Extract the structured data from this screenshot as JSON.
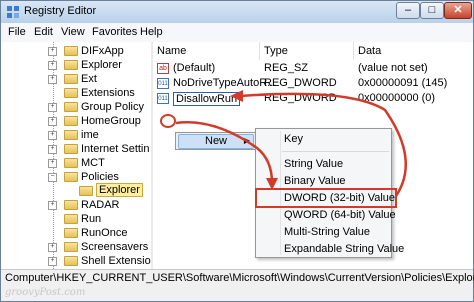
{
  "window": {
    "title": "Registry Editor"
  },
  "menubar": [
    "File",
    "Edit",
    "View",
    "Favorites",
    "Help"
  ],
  "tree": {
    "items": [
      {
        "label": "DIFxApp",
        "expander": "+"
      },
      {
        "label": "Explorer",
        "expander": "+"
      },
      {
        "label": "Ext",
        "expander": "+"
      },
      {
        "label": "Extensions",
        "expander": ""
      },
      {
        "label": "Group Policy",
        "expander": "+"
      },
      {
        "label": "HomeGroup",
        "expander": "+"
      },
      {
        "label": "ime",
        "expander": "+"
      },
      {
        "label": "Internet Settin",
        "expander": "+"
      },
      {
        "label": "MCT",
        "expander": "+"
      },
      {
        "label": "Policies",
        "expander": "−"
      },
      {
        "label": "Explorer",
        "expander": "",
        "selected": true
      },
      {
        "label": "RADAR",
        "expander": "+"
      },
      {
        "label": "Run",
        "expander": ""
      },
      {
        "label": "RunOnce",
        "expander": ""
      },
      {
        "label": "Screensavers",
        "expander": "+"
      },
      {
        "label": "Shell Extensio",
        "expander": "+"
      }
    ]
  },
  "list": {
    "headers": {
      "name": "Name",
      "type": "Type",
      "data": "Data"
    },
    "rows": [
      {
        "icon": "ab",
        "name": "(Default)",
        "type": "REG_SZ",
        "data": "(value not set)"
      },
      {
        "icon": "bin",
        "name": "NoDriveTypeAutoR...",
        "type": "REG_DWORD",
        "data": "0x00000091 (145)"
      },
      {
        "icon": "bin",
        "name": "DisallowRun",
        "type": "REG_DWORD",
        "data": "0x00000000 (0)",
        "editing": true
      }
    ]
  },
  "context_menu": {
    "new_label": "New"
  },
  "submenu": {
    "key": "Key",
    "items": [
      "String Value",
      "Binary Value",
      "DWORD (32-bit) Value",
      "QWORD (64-bit) Value",
      "Multi-String Value",
      "Expandable String Value"
    ]
  },
  "statusbar": {
    "path": "Computer\\HKEY_CURRENT_USER\\Software\\Microsoft\\Windows\\CurrentVersion\\Policies\\Explorer"
  },
  "watermark": "groovyPost.com",
  "colors": {
    "annotation_red": "#d23a2a",
    "selection_blue": "#cde1f6"
  },
  "icons": {
    "app": "registry-icon",
    "folder": "folder-icon",
    "string_value": "ab-icon",
    "dword_value": "binary-icon"
  }
}
